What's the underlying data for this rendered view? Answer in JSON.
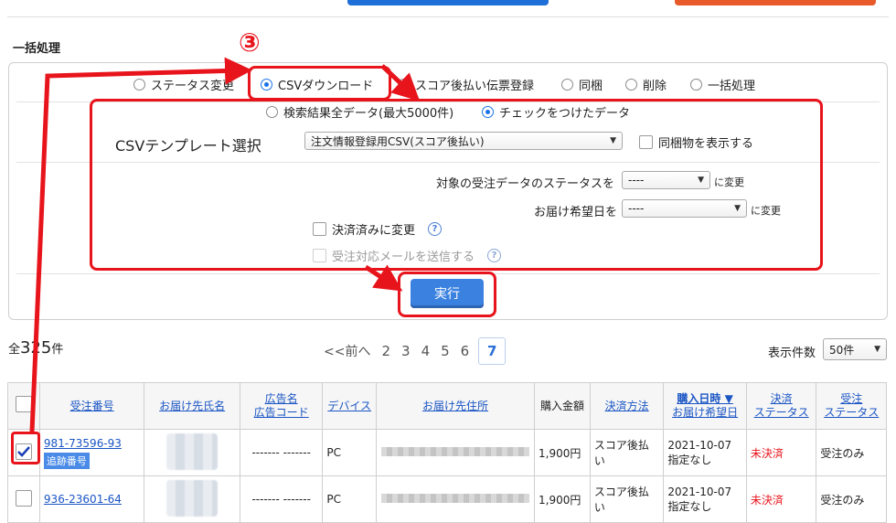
{
  "section_title": "一括処理",
  "step_number": "③",
  "operation_options": [
    {
      "label": "ステータス変更",
      "checked": false
    },
    {
      "label": "CSVダウンロード",
      "checked": true
    },
    {
      "label": "スコア後払い伝票登録",
      "checked": false
    },
    {
      "label": "同梱",
      "checked": false
    },
    {
      "label": "削除",
      "checked": false
    },
    {
      "label": "一括処理",
      "checked": false
    }
  ],
  "target_options": [
    {
      "label": "検索結果全データ(最大5000件)",
      "checked": false
    },
    {
      "label": "チェックをつけたデータ",
      "checked": true
    }
  ],
  "csv_template": {
    "label": "CSVテンプレート選択",
    "selected": "注文情報登録用CSV(スコア後払い)",
    "show_bundled_label": "同梱物を表示する"
  },
  "status_change": {
    "label": "対象の受注データのステータスを",
    "selected": "----",
    "suffix": "に変更"
  },
  "delivery_date_change": {
    "label": "お届け希望日を",
    "selected": "----",
    "suffix": "に変更"
  },
  "paid_change_label": "決済済みに変更",
  "send_mail_label": "受注対応メールを送信する",
  "help_glyph": "?",
  "execute_label": "実行",
  "total": {
    "prefix": "全",
    "count": "325",
    "suffix": "件"
  },
  "pager": {
    "prev_label": "<<前へ",
    "pages": [
      "2",
      "3",
      "4",
      "5",
      "6"
    ],
    "current": "7"
  },
  "per_page": {
    "label": "表示件数",
    "selected": "50件"
  },
  "table": {
    "headers": {
      "order_no": "受注番号",
      "recipient": "お届け先氏名",
      "ad_name": "広告名",
      "ad_code": "広告コード",
      "device": "デバイス",
      "address": "お届け先住所",
      "amount": "購入金額",
      "payment": "決済方法",
      "purchase_date": "購入日時 ▼",
      "delivery_date": "お届け希望日",
      "pay_status_1": "決済",
      "pay_status_2": "ステータス",
      "order_status_1": "受注",
      "order_status_2": "ステータス"
    },
    "rows": [
      {
        "checked": true,
        "order_no": "981-73596-93",
        "tracking_badge": "追跡番号",
        "ad": "------- -------",
        "device": "PC",
        "amount": "1,900円",
        "payment": "スコア後払い",
        "purchase_date": "2021-10-07",
        "delivery_date": "指定なし",
        "pay_status": "未決済",
        "order_status": "受注のみ"
      },
      {
        "checked": false,
        "order_no": "936-23601-64",
        "tracking_badge": "",
        "ad": "------- -------",
        "device": "PC",
        "amount": "1,900円",
        "payment": "スコア後払い",
        "purchase_date": "2021-10-07",
        "delivery_date": "指定なし",
        "pay_status": "未決済",
        "order_status": "受注のみ"
      }
    ]
  },
  "colors": {
    "annotation_red": "#e8141c",
    "accent_blue": "#3b82e0",
    "top_button_blue": "#1f6fd8",
    "top_button_orange": "#e85a2a"
  }
}
